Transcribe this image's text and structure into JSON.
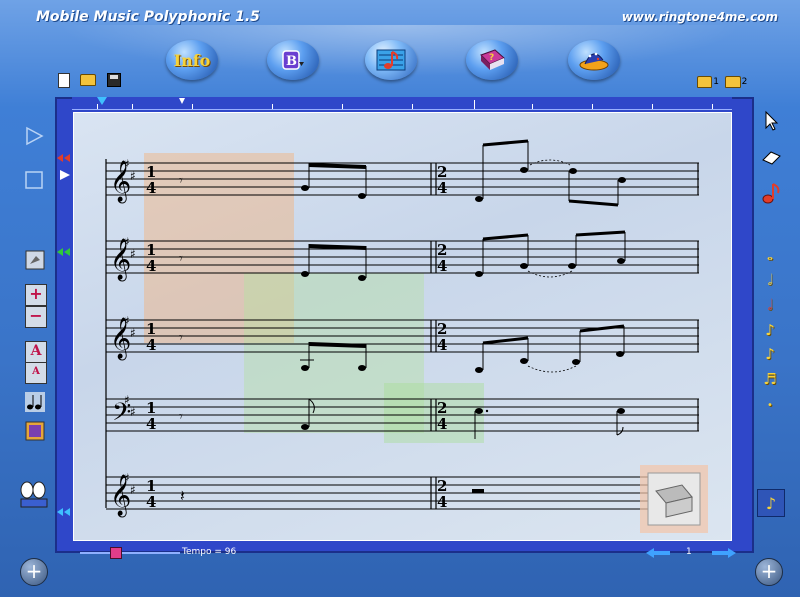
{
  "app": {
    "title": "Mobile Music Polyphonic 1.5",
    "site": "www.ringtone4me.com"
  },
  "toolbar": {
    "info_label": "Info",
    "buttons": [
      "info",
      "instrument",
      "score-editor",
      "help",
      "ringtone-wizard"
    ]
  },
  "file_icons": [
    "new-file-icon",
    "open-file-icon",
    "save-file-icon"
  ],
  "track_icons": [
    "track-folder-1-icon",
    "track-folder-2-icon"
  ],
  "track_folder_labels": [
    "1",
    "2"
  ],
  "score": {
    "staves": [
      {
        "clef": "treble",
        "key": "D major (2 sharps)",
        "time1": "1/4",
        "time2": "2/4"
      },
      {
        "clef": "treble",
        "key": "D major (2 sharps)",
        "time1": "1/4",
        "time2": "2/4"
      },
      {
        "clef": "treble",
        "key": "D major (2 sharps)",
        "time1": "1/4",
        "time2": "2/4"
      },
      {
        "clef": "bass",
        "key": "D major (2 sharps)",
        "time1": "1/4",
        "time2": "2/4"
      },
      {
        "clef": "treble",
        "key": "D major (2 sharps)",
        "time1": "1/4",
        "time2": "2/4"
      }
    ],
    "time_num_1": "1",
    "time_den_1": "4",
    "time_num_2": "2",
    "time_den_2": "4"
  },
  "left_tools": {
    "zoom_plus": "+",
    "zoom_minus": "−",
    "font_big": "A",
    "font_small": "A"
  },
  "right_tools": [
    "pointer-icon",
    "eraser-icon",
    "note-icon"
  ],
  "durations": [
    "whole",
    "half",
    "half-red",
    "quarter",
    "eighth",
    "sixteenth",
    "dot"
  ],
  "bottom": {
    "tempo_label": "Tempo = 96",
    "page": "1"
  },
  "colors": {
    "frame": "#3a74c8",
    "score_border": "#2f47c9",
    "accent": "#f6d23a",
    "tempo_thumb": "#e23d8a"
  }
}
